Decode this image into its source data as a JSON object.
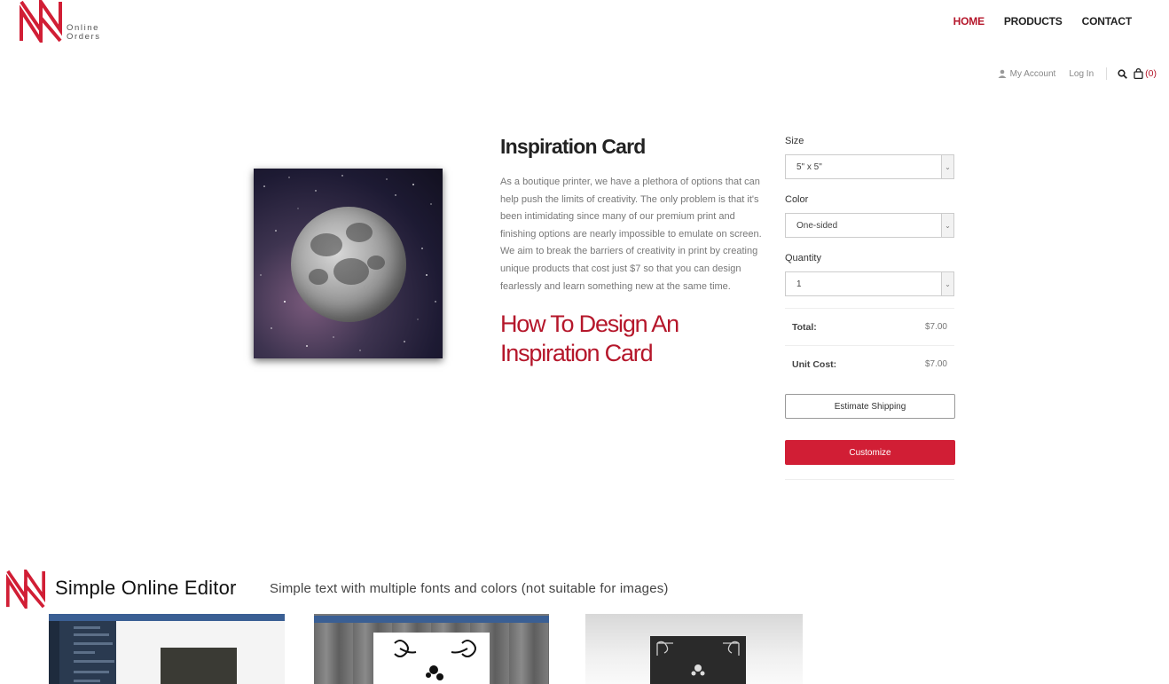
{
  "header": {
    "logo_text_line1": "Online",
    "logo_text_line2": "Orders",
    "nav": [
      {
        "label": "HOME",
        "active": true
      },
      {
        "label": "PRODUCTS",
        "active": false
      },
      {
        "label": "CONTACT",
        "active": false
      }
    ],
    "util": {
      "account_label": "My Account",
      "login_label": "Log In",
      "cart_count": "(0)"
    }
  },
  "product": {
    "title": "Inspiration Card",
    "description": "As a boutique printer, we have a plethora of options that can help push the limits of creativity. The only problem is that it's been intimidating since many of our premium print and finishing options are nearly impossible to emulate on screen. We aim to break the barriers of creativity in print by creating unique products that cost just $7 so that you can design fearlessly and learn something new at the same time.",
    "howto_heading": "How To Design An Inspiration Card"
  },
  "options": {
    "size_label": "Size",
    "size_value": "5\" x 5\"",
    "color_label": "Color",
    "color_value": "One-sided",
    "quantity_label": "Quantity",
    "quantity_value": "1",
    "total_label": "Total:",
    "total_value": "$7.00",
    "unit_cost_label": "Unit Cost:",
    "unit_cost_value": "$7.00",
    "estimate_shipping_label": "Estimate Shipping",
    "customize_label": "Customize"
  },
  "editor_section": {
    "title": "Simple Online Editor",
    "subtitle": "Simple text with multiple fonts and colors (not suitable for images)"
  },
  "colors": {
    "brand_red": "#d11e35",
    "heading_red": "#b5172b"
  },
  "icons": [
    "logo-icon",
    "user-icon",
    "search-icon",
    "shopping-bag-icon",
    "chevron-down-icon"
  ]
}
